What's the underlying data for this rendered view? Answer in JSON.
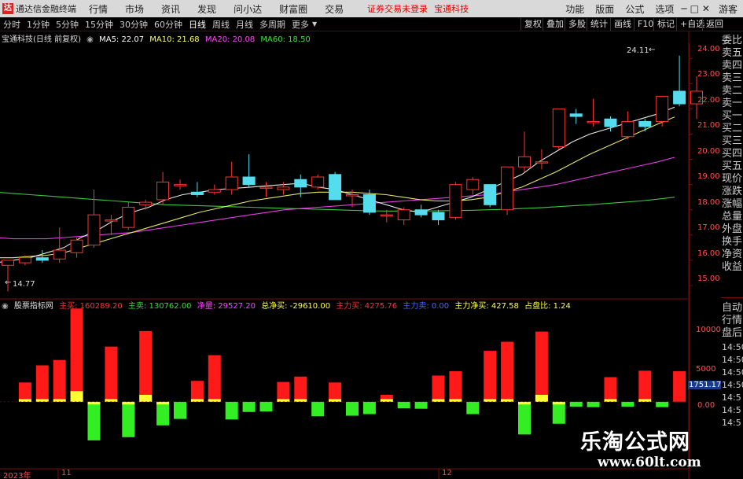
{
  "titlebar": {
    "app_name": "通达信金融终端",
    "menus": [
      "行情",
      "市场",
      "资讯",
      "发现",
      "问小达",
      "财富圈",
      "交易"
    ],
    "warning": "证券交易未登录",
    "stock_name": "宝通科技",
    "right_items": [
      "功能",
      "版面",
      "公式",
      "选项"
    ],
    "guest": "游客"
  },
  "toolbar": {
    "timeframes": [
      "分时",
      "1分钟",
      "5分钟",
      "15分钟",
      "30分钟",
      "60分钟",
      "日线",
      "周线",
      "月线",
      "多周期",
      "更多"
    ],
    "active": "日线",
    "right_buttons": [
      "复权",
      "叠加",
      "多股",
      "统计",
      "画线",
      "F10",
      "标记",
      "+自选",
      "返回"
    ]
  },
  "main_legend": {
    "title": "宝通科技(日线 前复权)",
    "ma5": "MA5: 22.07",
    "ma10": "MA10: 21.68",
    "ma20": "MA20: 20.08",
    "ma60": "MA60: 18.50",
    "ma_colors": [
      "#ffffff",
      "#ffff66",
      "#ff44ff",
      "#44dd44"
    ]
  },
  "sub_legend": {
    "title": "股票指标网",
    "zhumai": "主买: 160289.20",
    "zhumai2": "主卖: 130762.00",
    "jingliang": "净量: 29527.20",
    "zongjing": "总净买: -29610.00",
    "zhulimai": "主力买: 4275.76",
    "zhulimai2": "主力卖: 0.00",
    "zhulijing": "主力净买: 427.58",
    "zhanpan": "占盘比: 1.24"
  },
  "price_axis": [
    "24.00",
    "23.00",
    "22.00",
    "21.00",
    "20.00",
    "19.00",
    "18.00",
    "17.00",
    "16.00",
    "15.00"
  ],
  "price_markers": {
    "high": "24.11",
    "low": "14.77"
  },
  "volume_axis": [
    "10000",
    "5000",
    "0.00"
  ],
  "volume_marker": "1751.17",
  "date_labels": [
    "2023年",
    "11",
    "12"
  ],
  "right_panel": {
    "top_items": [
      "委比",
      "卖五",
      "卖四",
      "卖三",
      "卖二",
      "卖一",
      "买一",
      "买二",
      "买三",
      "买四",
      "买五",
      "现价",
      "涨跌",
      "涨幅",
      "总量",
      "外盘",
      "换手",
      "净资",
      "收益"
    ],
    "bottom_items": [
      "自动",
      "行情",
      "盘后",
      "14:50",
      "14:50",
      "14:50",
      "14:50",
      "14:5",
      "14:5",
      "14:5"
    ]
  },
  "watermark": {
    "cn": "乐淘公式网",
    "url": "www.60lt.com"
  },
  "chart_data": {
    "type": "candlestick",
    "y_range": [
      14.5,
      24.6
    ],
    "candles": [
      {
        "o": 15.8,
        "h": 15.95,
        "l": 14.77,
        "c": 16.0
      },
      {
        "o": 15.9,
        "h": 16.2,
        "l": 15.8,
        "c": 16.1
      },
      {
        "o": 16.1,
        "h": 16.4,
        "l": 15.9,
        "c": 16.0
      },
      {
        "o": 16.05,
        "h": 17.3,
        "l": 15.9,
        "c": 16.4
      },
      {
        "o": 16.3,
        "h": 16.9,
        "l": 16.1,
        "c": 16.8
      },
      {
        "o": 16.6,
        "h": 18.8,
        "l": 16.5,
        "c": 17.8
      },
      {
        "o": 17.6,
        "h": 17.8,
        "l": 17.0,
        "c": 17.6
      },
      {
        "o": 17.3,
        "h": 18.3,
        "l": 17.2,
        "c": 18.1
      },
      {
        "o": 18.2,
        "h": 18.4,
        "l": 18.0,
        "c": 18.3
      },
      {
        "o": 18.4,
        "h": 19.5,
        "l": 18.2,
        "c": 19.1
      },
      {
        "o": 19.0,
        "h": 19.2,
        "l": 18.8,
        "c": 19.0
      },
      {
        "o": 18.7,
        "h": 19.1,
        "l": 18.5,
        "c": 18.6
      },
      {
        "o": 18.7,
        "h": 19.0,
        "l": 18.6,
        "c": 18.8
      },
      {
        "o": 18.8,
        "h": 19.9,
        "l": 18.6,
        "c": 19.3
      },
      {
        "o": 19.3,
        "h": 20.2,
        "l": 18.9,
        "c": 19.0
      },
      {
        "o": 18.9,
        "h": 19.1,
        "l": 18.5,
        "c": 18.9
      },
      {
        "o": 18.8,
        "h": 19.1,
        "l": 18.6,
        "c": 18.9
      },
      {
        "o": 19.2,
        "h": 19.4,
        "l": 18.5,
        "c": 18.9
      },
      {
        "o": 18.9,
        "h": 19.4,
        "l": 18.8,
        "c": 19.3
      },
      {
        "o": 19.4,
        "h": 19.5,
        "l": 18.9,
        "c": 18.4
      },
      {
        "o": 18.6,
        "h": 18.8,
        "l": 18.1,
        "c": 18.6
      },
      {
        "o": 18.6,
        "h": 18.8,
        "l": 17.8,
        "c": 17.9
      },
      {
        "o": 17.8,
        "h": 18.0,
        "l": 17.5,
        "c": 17.8
      },
      {
        "o": 17.6,
        "h": 18.1,
        "l": 17.4,
        "c": 18.0
      },
      {
        "o": 18.0,
        "h": 18.2,
        "l": 17.7,
        "c": 17.8
      },
      {
        "o": 17.9,
        "h": 18.0,
        "l": 17.4,
        "c": 17.6
      },
      {
        "o": 17.7,
        "h": 19.1,
        "l": 17.6,
        "c": 19.0
      },
      {
        "o": 18.8,
        "h": 19.3,
        "l": 18.6,
        "c": 19.2
      },
      {
        "o": 19.0,
        "h": 19.0,
        "l": 18.1,
        "c": 18.2
      },
      {
        "o": 18.0,
        "h": 19.2,
        "l": 17.8,
        "c": 19.7
      },
      {
        "o": 19.7,
        "h": 21.1,
        "l": 19.5,
        "c": 20.1
      },
      {
        "o": 19.9,
        "h": 20.4,
        "l": 19.6,
        "c": 19.9
      },
      {
        "o": 20.5,
        "h": 22.0,
        "l": 20.4,
        "c": 22.0
      },
      {
        "o": 21.8,
        "h": 22.0,
        "l": 21.4,
        "c": 21.7
      },
      {
        "o": 21.5,
        "h": 22.4,
        "l": 21.3,
        "c": 21.5
      },
      {
        "o": 21.6,
        "h": 21.7,
        "l": 21.1,
        "c": 21.3
      },
      {
        "o": 20.9,
        "h": 21.9,
        "l": 20.8,
        "c": 21.5
      },
      {
        "o": 21.5,
        "h": 21.6,
        "l": 21.1,
        "c": 21.3
      },
      {
        "o": 21.5,
        "h": 22.5,
        "l": 21.3,
        "c": 22.5
      },
      {
        "o": 22.7,
        "h": 24.11,
        "l": 22.1,
        "c": 22.2
      },
      {
        "o": 22.2,
        "h": 23.3,
        "l": 21.6,
        "c": 22.7
      }
    ],
    "ma5": [
      15.9,
      16.0,
      16.1,
      16.3,
      16.5,
      16.9,
      17.2,
      17.6,
      17.9,
      18.1,
      18.4,
      18.6,
      18.7,
      18.8,
      18.85,
      18.9,
      18.95,
      19.0,
      19.05,
      18.9,
      18.8,
      18.6,
      18.4,
      18.2,
      18.0,
      17.9,
      18.1,
      18.3,
      18.5,
      18.8,
      19.1,
      19.4,
      19.9,
      20.3,
      20.7,
      21.0,
      21.2,
      21.4,
      21.6,
      21.8,
      22.07
    ],
    "ma10": [
      16.1,
      16.1,
      16.15,
      16.2,
      16.3,
      16.5,
      16.7,
      16.9,
      17.1,
      17.3,
      17.5,
      17.7,
      17.9,
      18.05,
      18.2,
      18.35,
      18.45,
      18.55,
      18.65,
      18.7,
      18.7,
      18.7,
      18.65,
      18.6,
      18.5,
      18.4,
      18.35,
      18.35,
      18.4,
      18.5,
      18.7,
      18.9,
      19.2,
      19.5,
      19.85,
      20.2,
      20.5,
      20.8,
      21.1,
      21.4,
      21.68
    ],
    "ma20": [
      16.9,
      16.85,
      16.85,
      16.85,
      16.9,
      16.95,
      17.0,
      17.05,
      17.1,
      17.2,
      17.3,
      17.4,
      17.5,
      17.6,
      17.7,
      17.8,
      17.9,
      18.0,
      18.05,
      18.1,
      18.15,
      18.2,
      18.25,
      18.3,
      18.35,
      18.4,
      18.45,
      18.5,
      18.55,
      18.6,
      18.7,
      18.8,
      18.9,
      19.0,
      19.15,
      19.3,
      19.45,
      19.6,
      19.75,
      19.9,
      20.08
    ],
    "ma60": [
      18.7,
      18.65,
      18.6,
      18.55,
      18.5,
      18.45,
      18.4,
      18.35,
      18.3,
      18.25,
      18.2,
      18.18,
      18.16,
      18.14,
      18.12,
      18.1,
      18.08,
      18.06,
      18.04,
      18.02,
      18.0,
      17.98,
      17.96,
      17.95,
      17.95,
      17.95,
      17.96,
      17.97,
      17.98,
      18.0,
      18.02,
      18.05,
      18.08,
      18.12,
      18.16,
      18.2,
      18.25,
      18.3,
      18.35,
      18.42,
      18.5
    ],
    "sub_y_range": [
      -12500,
      17000
    ],
    "net_buy_bars": [
      0,
      3600,
      6800,
      7800,
      17400,
      -7200,
      10300,
      -6600,
      13200,
      -4400,
      -3200,
      3900,
      8700,
      -3300,
      -1900,
      -1800,
      3700,
      4700,
      -2700,
      3600,
      -2600,
      -2300,
      1300,
      -1200,
      -1300,
      4900,
      5700,
      -2300,
      9500,
      11200,
      -6100,
      13100,
      -4100,
      -900,
      -1000,
      4600,
      -900,
      5800,
      -1000,
      5700,
      0
    ],
    "net_buy_markers": [
      0,
      500,
      500,
      500,
      2000,
      -500,
      500,
      -500,
      1300,
      -500,
      0,
      500,
      500,
      0,
      0,
      0,
      500,
      500,
      0,
      500,
      0,
      0,
      500,
      0,
      0,
      500,
      500,
      0,
      500,
      500,
      -500,
      1300,
      -500,
      0,
      0,
      500,
      0,
      500,
      0,
      0,
      0
    ]
  }
}
